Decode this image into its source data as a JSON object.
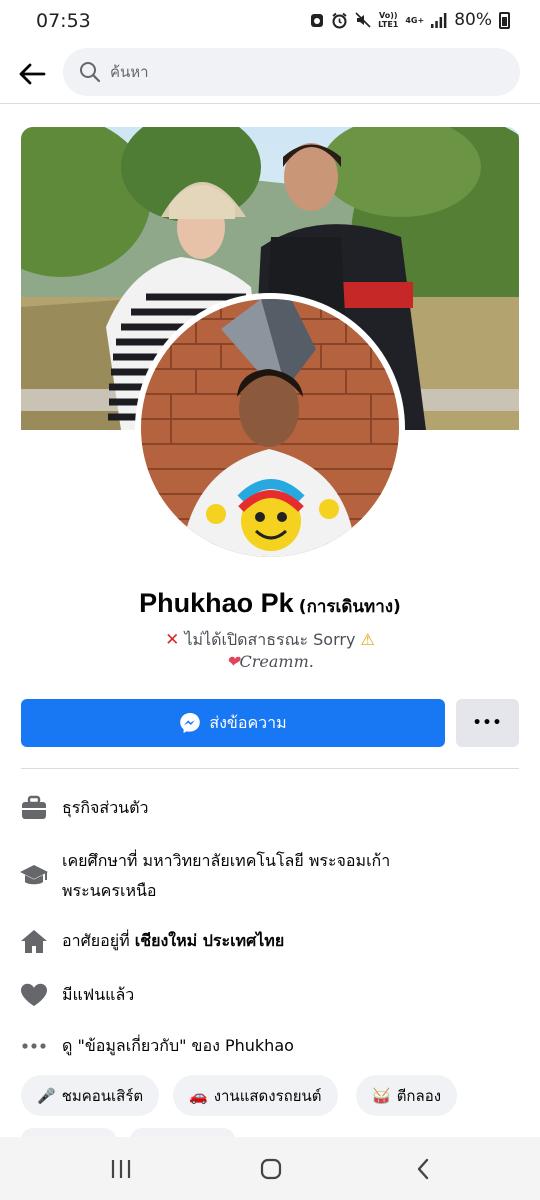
{
  "status_bar": {
    "time": "07:53",
    "volte_label": "Vo))\nLTE1",
    "network_label": "4G+",
    "battery_text": "80%"
  },
  "search": {
    "placeholder": "ค้นหา"
  },
  "profile": {
    "name": "Phukhao Pk",
    "alternate_name": "(การเดินทาง)",
    "bio_line1": "ไม่ได้เปิดสาธรณะ Sorry",
    "bio_line2": "Creamm."
  },
  "actions": {
    "message_label": "ส่งข้อความ",
    "more_label": "•••"
  },
  "details": {
    "work": "ธุรกิจส่วนตัว",
    "education_line1": "เคยศึกษาที่ มหาวิทยาลัยเทคโนโลยี พระจอมเก้า",
    "education_line2": "พระนครเหนือ",
    "lives_prefix": "อาศัยอยู่ที่",
    "lives_place": "เชียงใหม่ ประเทศไทย",
    "relationship": "มีแฟนแล้ว",
    "about_text": "ดู \"ข้อมูลเกี่ยวกับ\" ของ Phukhao"
  },
  "interests": [
    {
      "icon": "microphone-icon",
      "label": "ชมคอนเสิร์ต"
    },
    {
      "icon": "car-icon",
      "label": "งานแสดงรถยนต์"
    },
    {
      "icon": "drum-icon",
      "label": "ตีกลอง"
    }
  ],
  "colors": {
    "accent": "#1877f2",
    "secondary_button": "#e4e6eb",
    "chip_bg": "#f0f2f5"
  }
}
